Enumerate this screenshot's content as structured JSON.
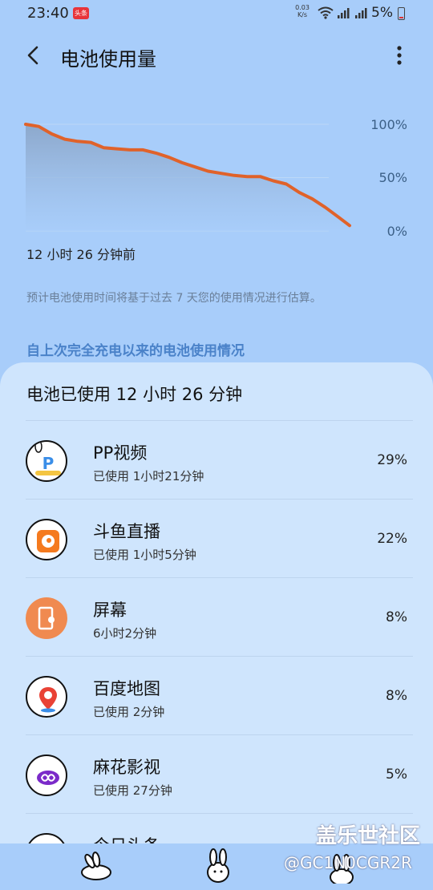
{
  "status_bar": {
    "time": "23:40",
    "notif_badge": "头条",
    "net_speed_value": "0.03",
    "net_speed_unit": "K/s",
    "battery_percent": "5%"
  },
  "header": {
    "title": "电池使用量"
  },
  "chart_data": {
    "type": "area",
    "y_ticks": [
      "100%",
      "50%",
      "0%"
    ],
    "ylim": [
      0,
      100
    ],
    "x_start_label": "12 小时 26 分钟前",
    "line_color": "#e0622a",
    "fill_color": "#8ba6c9",
    "series": [
      {
        "x": [
          0,
          0.5,
          1,
          1.5,
          2,
          2.5,
          3,
          3.5,
          4,
          4.5,
          5,
          5.5,
          6,
          6.5,
          7,
          7.5,
          8,
          8.5,
          9,
          9.5,
          10,
          10.5,
          11,
          11.5,
          12,
          12.43
        ],
        "values": [
          100,
          98,
          91,
          86,
          84,
          83,
          78,
          77,
          76,
          76,
          73,
          69,
          64,
          60,
          56,
          54,
          52,
          51,
          51,
          47,
          44,
          36,
          30,
          22,
          13,
          5
        ]
      }
    ]
  },
  "note": "预计电池使用时间将基于过去 7 天您的使用情况进行估算。",
  "section_title": "自上次完全充电以来的电池使用情况",
  "usage": {
    "total": "电池已使用 12 小时 26 分钟",
    "apps": [
      {
        "name": "PP视频",
        "usage": "已使用 1小时21分钟",
        "percent": "29%",
        "icon": "pp-video-icon"
      },
      {
        "name": "斗鱼直播",
        "usage": "已使用 1小时5分钟",
        "percent": "22%",
        "icon": "douyu-icon"
      },
      {
        "name": "屏幕",
        "usage": "6小时2分钟",
        "percent": "8%",
        "icon": "screen-icon"
      },
      {
        "name": "百度地图",
        "usage": "已使用 2分钟",
        "percent": "8%",
        "icon": "baidu-map-icon"
      },
      {
        "name": "麻花影视",
        "usage": "已使用 27分钟",
        "percent": "5%",
        "icon": "mahua-icon"
      },
      {
        "name": "今日头条",
        "usage": "",
        "percent": "",
        "icon": "toutiao-icon"
      }
    ]
  },
  "watermark": {
    "site": "盖乐世社区",
    "user": "@GC1N0CGR2R"
  }
}
